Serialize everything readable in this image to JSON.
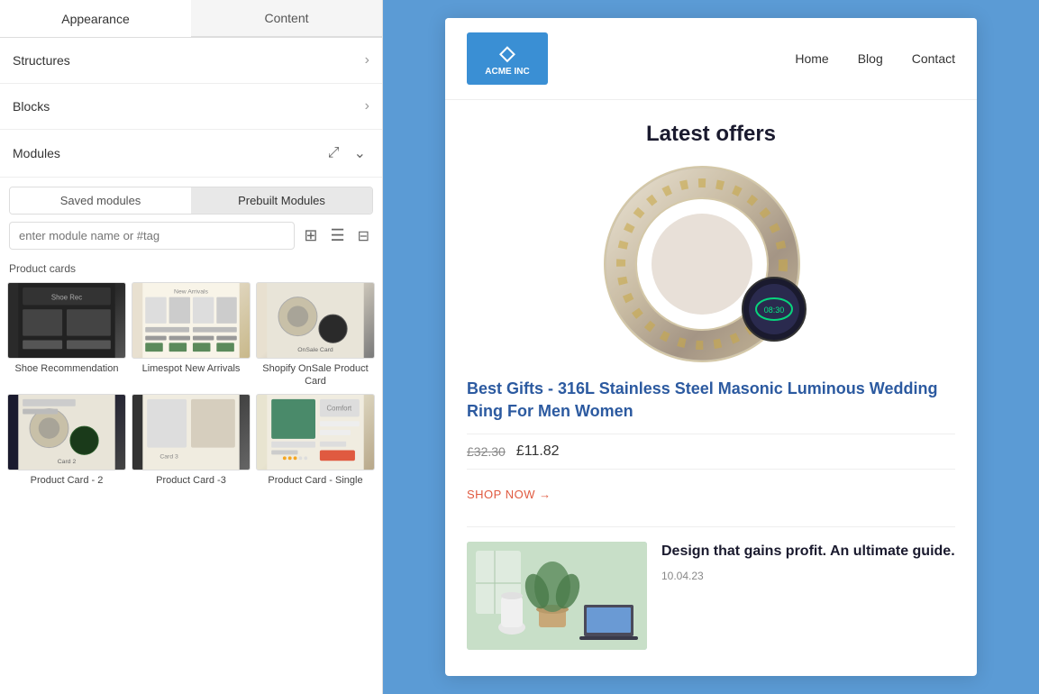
{
  "left_panel": {
    "tabs": [
      {
        "id": "appearance",
        "label": "Appearance",
        "active": true
      },
      {
        "id": "content",
        "label": "Content",
        "active": false
      }
    ],
    "nav_items": [
      {
        "id": "structures",
        "label": "Structures"
      },
      {
        "id": "blocks",
        "label": "Blocks"
      }
    ],
    "modules": {
      "title": "Modules",
      "sub_tabs": [
        {
          "id": "saved",
          "label": "Saved modules",
          "active": false
        },
        {
          "id": "prebuilt",
          "label": "Prebuilt Modules",
          "active": true
        }
      ],
      "search_placeholder": "enter module name or #tag"
    },
    "product_cards_label": "Product cards",
    "cards": [
      {
        "id": "shoe-rec",
        "label": "Shoe Recommendation",
        "thumb_class": "thumb-shoe"
      },
      {
        "id": "limespot",
        "label": "Limespot New Arrivals",
        "thumb_class": "thumb-lime"
      },
      {
        "id": "shopify-onsale",
        "label": "Shopify OnSale Product Card",
        "thumb_class": "thumb-shopify"
      },
      {
        "id": "product-card-2",
        "label": "Product Card - 2",
        "thumb_class": "thumb-card2"
      },
      {
        "id": "product-card-3",
        "label": "Product Card -3",
        "thumb_class": "thumb-card3"
      },
      {
        "id": "product-card-single",
        "label": "Product Card - Single",
        "thumb_class": "thumb-single"
      }
    ]
  },
  "preview": {
    "background_color": "#5b9bd5",
    "nav": {
      "logo_text": "ACME INC",
      "logo_icon": "◇",
      "links": [
        "Home",
        "Blog",
        "Contact"
      ]
    },
    "section_title": "Latest offers",
    "product": {
      "title": "Best Gifts - 316L Stainless Steel Masonic Luminous Wedding Ring For Men Women",
      "price_original": "£32.30",
      "price_sale": "£11.82",
      "cta": "SHOP NOW →"
    },
    "blog": {
      "title": "Design that gains profit. An ultimate guide.",
      "date": "10.04.23"
    }
  },
  "icons": {
    "chevron_right": "›",
    "expand": "⤢",
    "chevron_down": "⌄",
    "grid_view": "⊞",
    "list_view": "☰",
    "filter": "⊘"
  }
}
